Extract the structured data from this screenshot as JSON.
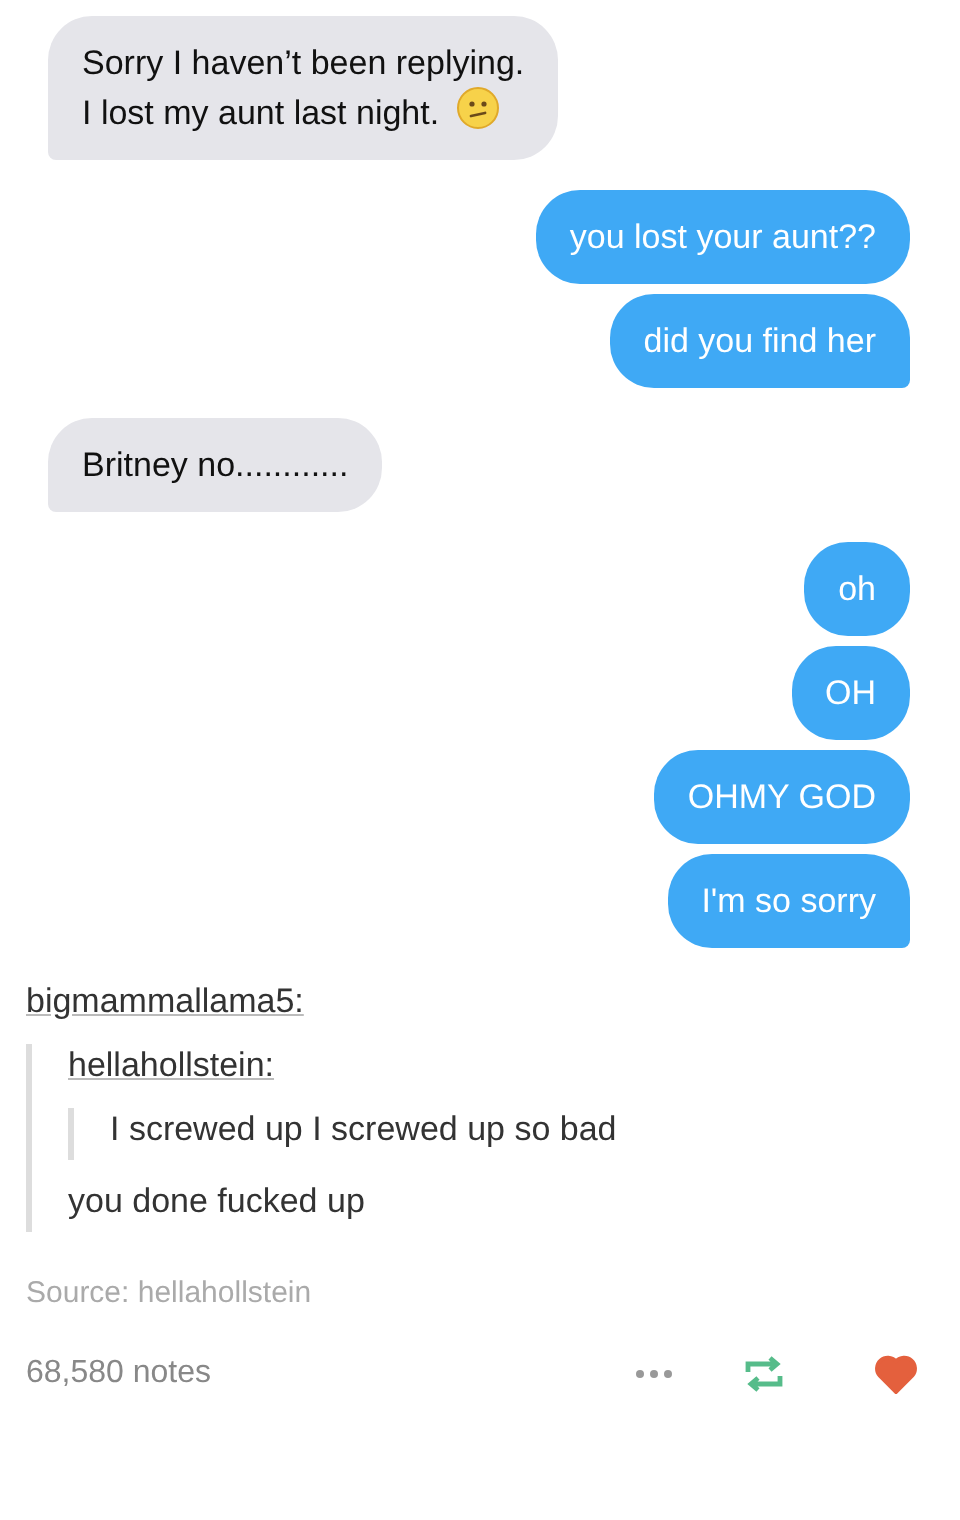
{
  "messages": [
    {
      "kind": "received",
      "text": "Sorry I haven’t been replying.\nI lost my aunt last night.",
      "emoji": true,
      "tail": true
    },
    {
      "kind": "sent",
      "text": "you lost your aunt??",
      "emoji": false,
      "tail": false
    },
    {
      "kind": "sent",
      "text": "did you find her",
      "emoji": false,
      "tail": true
    },
    {
      "kind": "received",
      "text": "Britney no............",
      "emoji": false,
      "tail": true
    },
    {
      "kind": "sent",
      "text": "oh",
      "emoji": false,
      "tail": false
    },
    {
      "kind": "sent",
      "text": "OH",
      "emoji": false,
      "tail": false
    },
    {
      "kind": "sent",
      "text": "OHMY GOD",
      "emoji": false,
      "tail": false
    },
    {
      "kind": "sent",
      "text": "I'm so sorry",
      "emoji": false,
      "tail": true
    }
  ],
  "post": {
    "trail": {
      "author": "bigmammallama5:",
      "quote": {
        "author": "hellahollstein:",
        "quote": {
          "body": "I screwed up I screwed up so bad"
        },
        "body": "you done fucked up"
      }
    },
    "source": "Source: hellahollstein",
    "notes": "68,580 notes",
    "liked": true
  }
}
